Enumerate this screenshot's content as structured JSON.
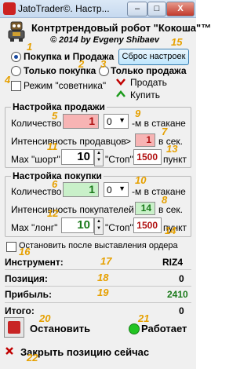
{
  "window": {
    "title": "JatoTrader©. Настр...",
    "minimize_glyph": "–",
    "maximize_glyph": "□",
    "close_glyph": "X"
  },
  "header": {
    "brand": "Контртрендовый робот \"Кокоша\"™",
    "copyright": "© 2014 by Evgeny Shibaev",
    "robot_icon": "robot-icon"
  },
  "mode": {
    "options": [
      {
        "label": "Покупка и Продажа",
        "selected": true
      },
      {
        "label": "Только покупка",
        "selected": false
      },
      {
        "label": "Только продажа",
        "selected": false
      }
    ],
    "reset_label": "Сброс настроек",
    "advisor_label": "Режим \"советника\"",
    "advisor_checked": false,
    "sell_label": "Продать",
    "buy_label": "Купить"
  },
  "sell": {
    "title": "Настройка продажи",
    "qty_label": "Количество",
    "qty_value": "1",
    "combo_value": "0",
    "combo_suffix": "-м в  стакане",
    "intensity_label": "Интенсивность продавцов",
    "intensity_op": ">",
    "intensity_value": "1",
    "intensity_unit": "в сек.",
    "max_label": "Max \"шорт\"",
    "max_value": "10",
    "stop_label": "\"Стоп\"",
    "stop_value": "1500",
    "stop_unit": "пункт"
  },
  "buy": {
    "title": "Настройка покупки",
    "qty_label": "Количество",
    "qty_value": "1",
    "combo_value": "0",
    "combo_suffix": "-м в  стакане",
    "intensity_label": "Интенсивность покупателей >",
    "intensity_value": "14",
    "intensity_unit": "в сек.",
    "max_label": "Max \"лонг\"",
    "max_value": "10",
    "stop_label": "\"Стоп\"",
    "stop_value": "1500",
    "stop_unit": "пункт"
  },
  "stop_after_order_label": "Остановить после выставления ордера",
  "stop_after_order_checked": false,
  "status": {
    "instrument_label": "Инструмент:",
    "instrument_value": "RIZ4",
    "position_label": "Позиция:",
    "position_value": "0",
    "profit_label": "Прибыль:",
    "profit_value": "2410",
    "total_label": "Итого:",
    "total_value": "0"
  },
  "controls": {
    "stop_label": "Остановить",
    "running_label": "Работает",
    "close_position_label": "Закрыть позицию сейчас"
  },
  "annotations": [
    "1",
    "2",
    "3",
    "4",
    "5",
    "6",
    "7",
    "8",
    "9",
    "10",
    "11",
    "12",
    "13",
    "14",
    "15",
    "16",
    "17",
    "18",
    "19",
    "20",
    "21",
    "22"
  ],
  "colors": {
    "annotation": "#e6a000",
    "sell_field_bg": "#f7b4b4",
    "buy_field_bg": "#c9f0c9",
    "stop_value": "#b01010",
    "profit_value": "#1a7a1a",
    "running_indicator": "#22c422",
    "sell_arrow": "#c00000",
    "buy_arrow": "#1a9a1a"
  }
}
